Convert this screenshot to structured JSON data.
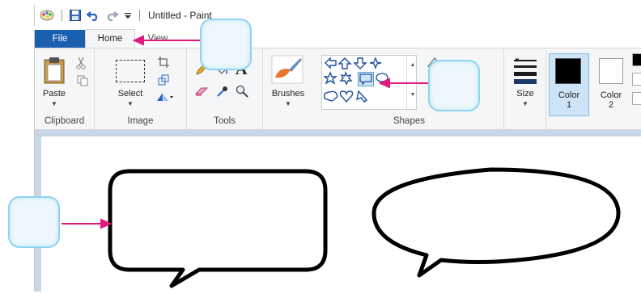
{
  "window": {
    "title": "Untitled - Paint"
  },
  "tabs": [
    {
      "label": "File"
    },
    {
      "label": "Home"
    },
    {
      "label": "View"
    }
  ],
  "ribbon": {
    "clipboard": {
      "group_label": "Clipboard",
      "paste_label": "Paste"
    },
    "image": {
      "group_label": "Image",
      "select_label": "Select"
    },
    "tools": {
      "group_label": "Tools"
    },
    "brushes": {
      "label": "Brushes"
    },
    "shapes": {
      "group_label": "Shapes"
    },
    "size": {
      "label": "Size"
    },
    "colors": {
      "color1_label": "Color",
      "color1_num": "1",
      "color2_label": "Color",
      "color2_num": "2"
    }
  },
  "colors": {
    "file_tab": "#1b5fb0",
    "arrow": "#e0197d",
    "callout_border": "#8ed3ef",
    "workspace": "#c8d6e8"
  },
  "icons": [
    "paint-app-icon",
    "save-icon",
    "undo-icon",
    "redo-icon",
    "customize-icon",
    "paste-icon",
    "cut-icon",
    "copy-icon",
    "select-icon",
    "crop-icon",
    "resize-icon",
    "rotate-icon",
    "pencil-icon",
    "fill-icon",
    "text-icon",
    "eraser-icon",
    "color-picker-icon",
    "magnifier-icon",
    "brushes-icon",
    "size-icon",
    "rounded-callout-shape-icon"
  ]
}
